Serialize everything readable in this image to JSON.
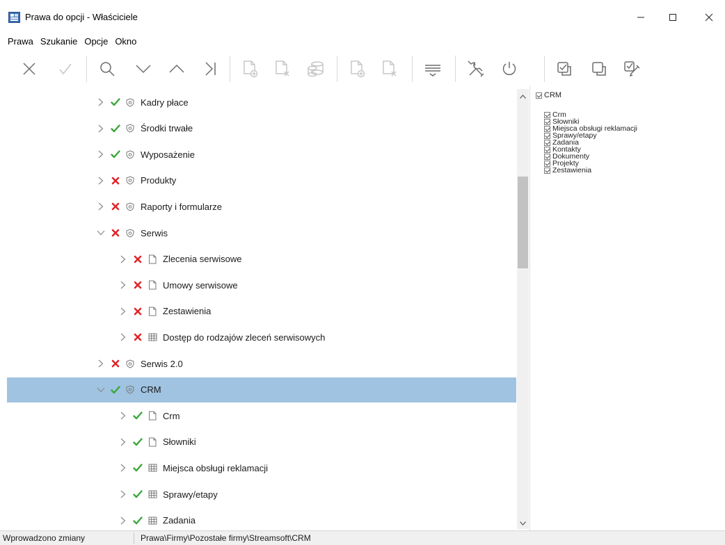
{
  "window": {
    "title": "Prawa do opcji - Właściciele",
    "minimize_glyph": "—",
    "maximize_glyph": "☐",
    "close_glyph": "✕"
  },
  "menu": [
    "Prawa",
    "Szukanie",
    "Opcje",
    "Okno"
  ],
  "toolbar": {
    "buttons": [
      {
        "icon": "close-icon",
        "enabled": true
      },
      {
        "icon": "check-icon",
        "enabled": false
      },
      {
        "icon": "search-icon",
        "enabled": true
      },
      {
        "icon": "chevron-down-icon",
        "enabled": true
      },
      {
        "icon": "chevron-up-icon",
        "enabled": true
      },
      {
        "icon": "skip-last-icon",
        "enabled": true
      },
      {
        "icon": "add-document-icon",
        "enabled": false
      },
      {
        "icon": "remove-document-icon",
        "enabled": false
      },
      {
        "icon": "database-icon",
        "enabled": false
      },
      {
        "icon": "add-document-icon",
        "enabled": false
      },
      {
        "icon": "remove-document-icon",
        "enabled": false
      },
      {
        "icon": "filter-lines-icon",
        "enabled": true
      },
      {
        "icon": "tools-icon",
        "enabled": true
      },
      {
        "icon": "power-icon",
        "enabled": true
      },
      {
        "icon": "check-all-icon",
        "enabled": true
      },
      {
        "icon": "uncheck-all-icon",
        "enabled": true
      },
      {
        "icon": "check-pencil-icon",
        "enabled": true
      }
    ]
  },
  "tree": {
    "rows": [
      {
        "label": "Kadry płace",
        "status": "allowed",
        "icon": "shield-icon",
        "level": 1,
        "expanded": false
      },
      {
        "label": "Środki trwałe",
        "status": "allowed",
        "icon": "shield-icon",
        "level": 1,
        "expanded": false
      },
      {
        "label": "Wyposażenie",
        "status": "allowed",
        "icon": "shield-icon",
        "level": 1,
        "expanded": false
      },
      {
        "label": "Produkty",
        "status": "denied",
        "icon": "shield-icon",
        "level": 1,
        "expanded": false
      },
      {
        "label": "Raporty i formularze",
        "status": "denied",
        "icon": "shield-icon",
        "level": 1,
        "expanded": false
      },
      {
        "label": "Serwis",
        "status": "denied",
        "icon": "shield-icon",
        "level": 1,
        "expanded": true
      },
      {
        "label": "Zlecenia serwisowe",
        "status": "denied",
        "icon": "document-icon",
        "level": 2,
        "expanded": false
      },
      {
        "label": "Umowy serwisowe",
        "status": "denied",
        "icon": "document-icon",
        "level": 2,
        "expanded": false
      },
      {
        "label": "Zestawienia",
        "status": "denied",
        "icon": "document-icon",
        "level": 2,
        "expanded": false
      },
      {
        "label": "Dostęp do rodzajów zleceń serwisowych",
        "status": "denied",
        "icon": "grid-icon",
        "level": 2,
        "expanded": false
      },
      {
        "label": "Serwis 2.0",
        "status": "denied",
        "icon": "shield-icon",
        "level": 1,
        "expanded": false
      },
      {
        "label": "CRM",
        "status": "allowed",
        "icon": "shield-icon",
        "level": 1,
        "expanded": true,
        "selected": true
      },
      {
        "label": "Crm",
        "status": "allowed",
        "icon": "document-icon",
        "level": 2,
        "expanded": false
      },
      {
        "label": "Słowniki",
        "status": "allowed",
        "icon": "document-icon",
        "level": 2,
        "expanded": false
      },
      {
        "label": "Miejsca obsługi reklamacji",
        "status": "allowed",
        "icon": "grid-icon",
        "level": 2,
        "expanded": false
      },
      {
        "label": "Sprawy/etapy",
        "status": "allowed",
        "icon": "grid-icon",
        "level": 2,
        "expanded": false
      },
      {
        "label": "Zadania",
        "status": "allowed",
        "icon": "grid-icon",
        "level": 2,
        "expanded": false
      }
    ]
  },
  "right_panel": {
    "header": {
      "label": "CRM",
      "checked": true
    },
    "items": [
      {
        "label": "Crm",
        "checked": true
      },
      {
        "label": "Słowniki",
        "checked": true
      },
      {
        "label": "Miejsca obsługi reklamacji",
        "checked": true
      },
      {
        "label": "Sprawy/etapy",
        "checked": true
      },
      {
        "label": "Zadania",
        "checked": true
      },
      {
        "label": "Kontakty",
        "checked": true
      },
      {
        "label": "Dokumenty",
        "checked": true
      },
      {
        "label": "Projekty",
        "checked": true
      },
      {
        "label": "Zestawienia",
        "checked": true
      }
    ]
  },
  "statusbar": {
    "left": "Wprowadzono zmiany",
    "path": "Prawa\\Firmy\\Pozostałe firmy\\Streamsoft\\CRM"
  },
  "colors": {
    "allowed": "#3aa63a",
    "denied": "#e0262b",
    "selection": "#9fc3e0",
    "app_icon": "#3a6db5"
  }
}
